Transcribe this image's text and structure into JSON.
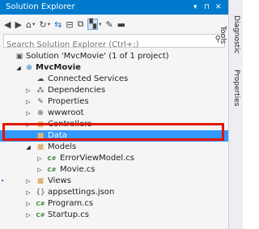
{
  "title": "Solution Explorer",
  "title_controls": [
    "▾",
    "⊓",
    "✕"
  ],
  "toolbar_icons": [
    "back-icon",
    "forward-icon",
    "home-icon",
    "dropdown-icon",
    "history-icon",
    "dropdown-icon",
    "sync-icon",
    "collapse-icon",
    "refresh-icon",
    "show-all-files-icon",
    "dropdown-icon",
    "properties-wrench-icon",
    "preview-icon"
  ],
  "search": {
    "placeholder": "Search Solution Explorer (Ctrl+;)",
    "value": ""
  },
  "tree": [
    {
      "label": "Solution 'MvcMovie' (1 of 1 project)",
      "icon": "solution-icon"
    },
    {
      "label": "MvcMovie",
      "icon": "web-project-icon",
      "expanded": true,
      "bold": true
    },
    {
      "label": "Connected Services",
      "icon": "connected-services-icon"
    },
    {
      "label": "Dependencies",
      "icon": "dependencies-icon",
      "collapsed": true
    },
    {
      "label": "Properties",
      "icon": "wrench-icon",
      "collapsed": true
    },
    {
      "label": "wwwroot",
      "icon": "globe-icon",
      "collapsed": true
    },
    {
      "label": "Controllers",
      "icon": "folder-icon",
      "collapsed": true
    },
    {
      "label": "Data",
      "icon": "folder-icon",
      "selected": true
    },
    {
      "label": "Models",
      "icon": "folder-icon",
      "expanded": true
    },
    {
      "label": "ErrorViewModel.cs",
      "icon": "csharp-file-icon",
      "collapsed": true
    },
    {
      "label": "Movie.cs",
      "icon": "csharp-file-icon",
      "collapsed": true
    },
    {
      "label": "Views",
      "icon": "folder-icon",
      "collapsed": true
    },
    {
      "label": "appsettings.json",
      "icon": "json-file-icon",
      "collapsed": true
    },
    {
      "label": "Program.cs",
      "icon": "csharp-file-icon",
      "collapsed": true
    },
    {
      "label": "Startup.cs",
      "icon": "csharp-file-icon",
      "collapsed": true
    }
  ],
  "side_tabs": [
    "Diagnostic Tools",
    "Properties"
  ],
  "colors": {
    "title_bar": "#007acc",
    "selection": "#3399ff",
    "highlight_box": "#e51400",
    "folder": "#dcb67a"
  }
}
